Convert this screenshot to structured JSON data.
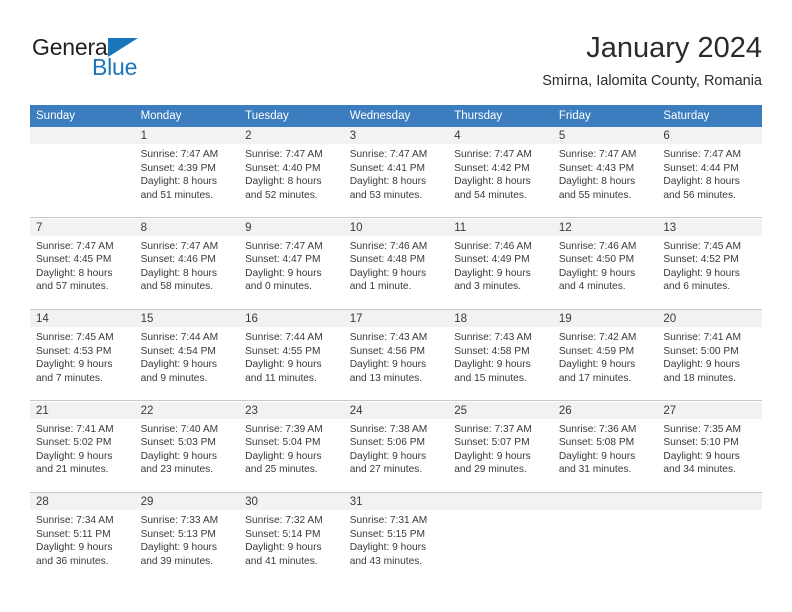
{
  "brand": {
    "name_top": "General",
    "name_bottom": "Blue",
    "accent_color": "#1b75bb"
  },
  "header": {
    "title": "January 2024",
    "subtitle": "Smirna, Ialomita County, Romania"
  },
  "theme": {
    "header_row_bg": "#3b7dbf",
    "day_band_bg": "#f2f2f2",
    "text_color": "#3a3a3a",
    "separator_color": "#c8c8c8"
  },
  "weekday_headers": [
    "Sunday",
    "Monday",
    "Tuesday",
    "Wednesday",
    "Thursday",
    "Friday",
    "Saturday"
  ],
  "weeks": [
    [
      {
        "day": "",
        "sunrise": "",
        "sunset": "",
        "daylight_line1": "",
        "daylight_line2": ""
      },
      {
        "day": "1",
        "sunrise": "Sunrise: 7:47 AM",
        "sunset": "Sunset: 4:39 PM",
        "daylight_line1": "Daylight: 8 hours",
        "daylight_line2": "and 51 minutes."
      },
      {
        "day": "2",
        "sunrise": "Sunrise: 7:47 AM",
        "sunset": "Sunset: 4:40 PM",
        "daylight_line1": "Daylight: 8 hours",
        "daylight_line2": "and 52 minutes."
      },
      {
        "day": "3",
        "sunrise": "Sunrise: 7:47 AM",
        "sunset": "Sunset: 4:41 PM",
        "daylight_line1": "Daylight: 8 hours",
        "daylight_line2": "and 53 minutes."
      },
      {
        "day": "4",
        "sunrise": "Sunrise: 7:47 AM",
        "sunset": "Sunset: 4:42 PM",
        "daylight_line1": "Daylight: 8 hours",
        "daylight_line2": "and 54 minutes."
      },
      {
        "day": "5",
        "sunrise": "Sunrise: 7:47 AM",
        "sunset": "Sunset: 4:43 PM",
        "daylight_line1": "Daylight: 8 hours",
        "daylight_line2": "and 55 minutes."
      },
      {
        "day": "6",
        "sunrise": "Sunrise: 7:47 AM",
        "sunset": "Sunset: 4:44 PM",
        "daylight_line1": "Daylight: 8 hours",
        "daylight_line2": "and 56 minutes."
      }
    ],
    [
      {
        "day": "7",
        "sunrise": "Sunrise: 7:47 AM",
        "sunset": "Sunset: 4:45 PM",
        "daylight_line1": "Daylight: 8 hours",
        "daylight_line2": "and 57 minutes."
      },
      {
        "day": "8",
        "sunrise": "Sunrise: 7:47 AM",
        "sunset": "Sunset: 4:46 PM",
        "daylight_line1": "Daylight: 8 hours",
        "daylight_line2": "and 58 minutes."
      },
      {
        "day": "9",
        "sunrise": "Sunrise: 7:47 AM",
        "sunset": "Sunset: 4:47 PM",
        "daylight_line1": "Daylight: 9 hours",
        "daylight_line2": "and 0 minutes."
      },
      {
        "day": "10",
        "sunrise": "Sunrise: 7:46 AM",
        "sunset": "Sunset: 4:48 PM",
        "daylight_line1": "Daylight: 9 hours",
        "daylight_line2": "and 1 minute."
      },
      {
        "day": "11",
        "sunrise": "Sunrise: 7:46 AM",
        "sunset": "Sunset: 4:49 PM",
        "daylight_line1": "Daylight: 9 hours",
        "daylight_line2": "and 3 minutes."
      },
      {
        "day": "12",
        "sunrise": "Sunrise: 7:46 AM",
        "sunset": "Sunset: 4:50 PM",
        "daylight_line1": "Daylight: 9 hours",
        "daylight_line2": "and 4 minutes."
      },
      {
        "day": "13",
        "sunrise": "Sunrise: 7:45 AM",
        "sunset": "Sunset: 4:52 PM",
        "daylight_line1": "Daylight: 9 hours",
        "daylight_line2": "and 6 minutes."
      }
    ],
    [
      {
        "day": "14",
        "sunrise": "Sunrise: 7:45 AM",
        "sunset": "Sunset: 4:53 PM",
        "daylight_line1": "Daylight: 9 hours",
        "daylight_line2": "and 7 minutes."
      },
      {
        "day": "15",
        "sunrise": "Sunrise: 7:44 AM",
        "sunset": "Sunset: 4:54 PM",
        "daylight_line1": "Daylight: 9 hours",
        "daylight_line2": "and 9 minutes."
      },
      {
        "day": "16",
        "sunrise": "Sunrise: 7:44 AM",
        "sunset": "Sunset: 4:55 PM",
        "daylight_line1": "Daylight: 9 hours",
        "daylight_line2": "and 11 minutes."
      },
      {
        "day": "17",
        "sunrise": "Sunrise: 7:43 AM",
        "sunset": "Sunset: 4:56 PM",
        "daylight_line1": "Daylight: 9 hours",
        "daylight_line2": "and 13 minutes."
      },
      {
        "day": "18",
        "sunrise": "Sunrise: 7:43 AM",
        "sunset": "Sunset: 4:58 PM",
        "daylight_line1": "Daylight: 9 hours",
        "daylight_line2": "and 15 minutes."
      },
      {
        "day": "19",
        "sunrise": "Sunrise: 7:42 AM",
        "sunset": "Sunset: 4:59 PM",
        "daylight_line1": "Daylight: 9 hours",
        "daylight_line2": "and 17 minutes."
      },
      {
        "day": "20",
        "sunrise": "Sunrise: 7:41 AM",
        "sunset": "Sunset: 5:00 PM",
        "daylight_line1": "Daylight: 9 hours",
        "daylight_line2": "and 18 minutes."
      }
    ],
    [
      {
        "day": "21",
        "sunrise": "Sunrise: 7:41 AM",
        "sunset": "Sunset: 5:02 PM",
        "daylight_line1": "Daylight: 9 hours",
        "daylight_line2": "and 21 minutes."
      },
      {
        "day": "22",
        "sunrise": "Sunrise: 7:40 AM",
        "sunset": "Sunset: 5:03 PM",
        "daylight_line1": "Daylight: 9 hours",
        "daylight_line2": "and 23 minutes."
      },
      {
        "day": "23",
        "sunrise": "Sunrise: 7:39 AM",
        "sunset": "Sunset: 5:04 PM",
        "daylight_line1": "Daylight: 9 hours",
        "daylight_line2": "and 25 minutes."
      },
      {
        "day": "24",
        "sunrise": "Sunrise: 7:38 AM",
        "sunset": "Sunset: 5:06 PM",
        "daylight_line1": "Daylight: 9 hours",
        "daylight_line2": "and 27 minutes."
      },
      {
        "day": "25",
        "sunrise": "Sunrise: 7:37 AM",
        "sunset": "Sunset: 5:07 PM",
        "daylight_line1": "Daylight: 9 hours",
        "daylight_line2": "and 29 minutes."
      },
      {
        "day": "26",
        "sunrise": "Sunrise: 7:36 AM",
        "sunset": "Sunset: 5:08 PM",
        "daylight_line1": "Daylight: 9 hours",
        "daylight_line2": "and 31 minutes."
      },
      {
        "day": "27",
        "sunrise": "Sunrise: 7:35 AM",
        "sunset": "Sunset: 5:10 PM",
        "daylight_line1": "Daylight: 9 hours",
        "daylight_line2": "and 34 minutes."
      }
    ],
    [
      {
        "day": "28",
        "sunrise": "Sunrise: 7:34 AM",
        "sunset": "Sunset: 5:11 PM",
        "daylight_line1": "Daylight: 9 hours",
        "daylight_line2": "and 36 minutes."
      },
      {
        "day": "29",
        "sunrise": "Sunrise: 7:33 AM",
        "sunset": "Sunset: 5:13 PM",
        "daylight_line1": "Daylight: 9 hours",
        "daylight_line2": "and 39 minutes."
      },
      {
        "day": "30",
        "sunrise": "Sunrise: 7:32 AM",
        "sunset": "Sunset: 5:14 PM",
        "daylight_line1": "Daylight: 9 hours",
        "daylight_line2": "and 41 minutes."
      },
      {
        "day": "31",
        "sunrise": "Sunrise: 7:31 AM",
        "sunset": "Sunset: 5:15 PM",
        "daylight_line1": "Daylight: 9 hours",
        "daylight_line2": "and 43 minutes."
      },
      {
        "day": "",
        "sunrise": "",
        "sunset": "",
        "daylight_line1": "",
        "daylight_line2": ""
      },
      {
        "day": "",
        "sunrise": "",
        "sunset": "",
        "daylight_line1": "",
        "daylight_line2": ""
      },
      {
        "day": "",
        "sunrise": "",
        "sunset": "",
        "daylight_line1": "",
        "daylight_line2": ""
      }
    ]
  ]
}
